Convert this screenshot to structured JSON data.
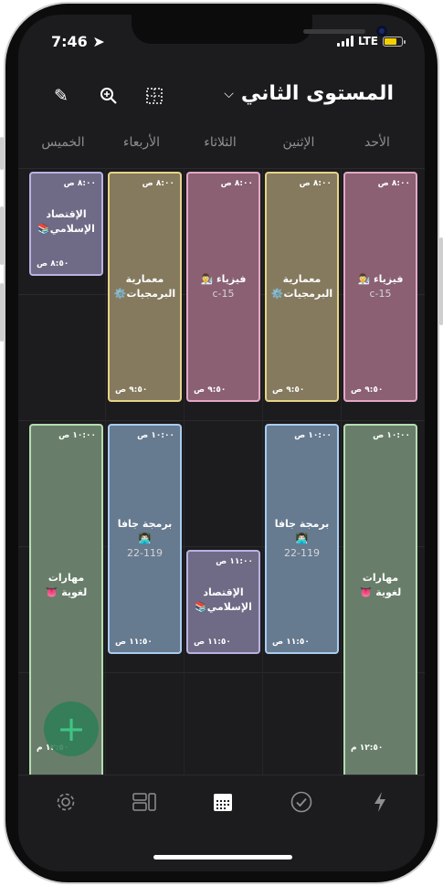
{
  "status": {
    "time": "7:46",
    "network": "LTE"
  },
  "header": {
    "title": "المستوى الثاني",
    "tools": [
      "pencil-icon",
      "zoom-icon",
      "grid-select-icon"
    ]
  },
  "days": [
    "الأحد",
    "الإثنين",
    "الثلاثاء",
    "الأربعاء",
    "الخميس"
  ],
  "colors": {
    "purple": "#6f6a86",
    "yellow": "#857a5e",
    "pink": "#8a6072",
    "green": "#687e6a",
    "blue": "#667a90"
  },
  "blocks": [
    {
      "id": "sun1",
      "name": "فيزياء 👨‍🔬",
      "room": "c-15",
      "start": "٨:٠٠ ص",
      "end": "٩:٥٠ ص"
    },
    {
      "id": "mon1",
      "name": "معمارية البرمجيات⚙️",
      "room": "",
      "start": "٨:٠٠ ص",
      "end": "٩:٥٠ ص"
    },
    {
      "id": "tue1",
      "name": "فيزياء 👨‍🔬",
      "room": "c-15",
      "start": "٨:٠٠ ص",
      "end": "٩:٥٠ ص"
    },
    {
      "id": "wed1",
      "name": "معمارية البرمجيات⚙️",
      "room": "",
      "start": "٨:٠٠ ص",
      "end": "٩:٥٠ ص"
    },
    {
      "id": "thu1",
      "name": "الإقتصاد الإسلامي📚",
      "room": "",
      "start": "٨:٠٠ ص",
      "end": "٨:٥٠ ص"
    },
    {
      "id": "sun2",
      "name": "مهارات لغوية 👅",
      "room": "",
      "start": "١٠:٠٠ ص",
      "end": "١٢:٥٠ م"
    },
    {
      "id": "mon2",
      "name": "برمجة جافا👨🏻‍💻",
      "room": "22-119",
      "start": "١٠:٠٠ ص",
      "end": "١١:٥٠ ص"
    },
    {
      "id": "tue2",
      "name": "الإقتصاد الإسلامي📚",
      "room": "",
      "start": "١١:٠٠ ص",
      "end": "١١:٥٠ ص"
    },
    {
      "id": "wed2",
      "name": "برمجة جافا👨🏻‍💻",
      "room": "22-119",
      "start": "١٠:٠٠ ص",
      "end": "١١:٥٠ ص"
    },
    {
      "id": "thu2",
      "name": "مهارات لغوية 👅",
      "room": "",
      "start": "١٠:٠٠ ص",
      "end": "١٢:٥٠ م"
    }
  ],
  "tabbar": [
    "settings-icon",
    "widgets-icon",
    "calendar-icon",
    "check-icon",
    "bolt-icon"
  ]
}
